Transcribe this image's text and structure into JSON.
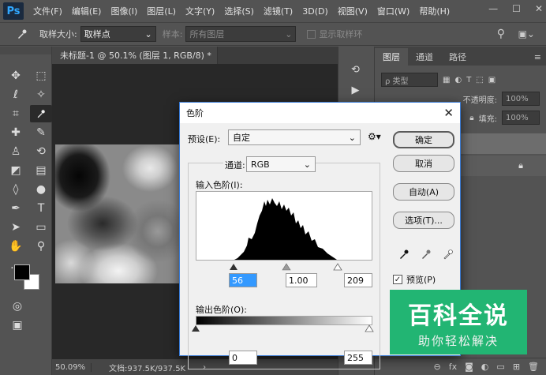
{
  "app": {
    "logo": "Ps"
  },
  "menubar": {
    "items": [
      "文件(F)",
      "编辑(E)",
      "图像(I)",
      "图层(L)",
      "文字(Y)",
      "选择(S)",
      "滤镜(T)",
      "3D(D)",
      "视图(V)",
      "窗口(W)",
      "帮助(H)"
    ],
    "window_controls": [
      "—",
      "☐",
      "✕"
    ]
  },
  "options": {
    "sample_size_label": "取样大小:",
    "sample_size_value": "取样点",
    "sample_label": "样本:",
    "sample_value": "所有图层",
    "show_ring_label": "显示取样环"
  },
  "document": {
    "tab_title": "未标题-1 @ 50.1% (图层 1, RGB/8) *",
    "zoom": "50.09%",
    "doc_info": "文档:937.5K/937.5K"
  },
  "layers_panel": {
    "tabs": [
      "图层",
      "通道",
      "路径"
    ],
    "filter_label": "ρ 类型",
    "opacity_label": "不透明度:",
    "opacity_value": "100%",
    "fill_label": "填充:",
    "fill_value": "100%"
  },
  "levels_dialog": {
    "title": "色阶",
    "close": "✕",
    "preset_label": "预设(E):",
    "preset_value": "自定",
    "channel_label": "通道:",
    "channel_value": "RGB",
    "input_label": "输入色阶(I):",
    "input_black": "56",
    "input_gamma": "1.00",
    "input_white": "209",
    "output_label": "输出色阶(O):",
    "output_black": "0",
    "output_white": "255",
    "buttons": {
      "ok": "确定",
      "cancel": "取消",
      "auto": "自动(A)",
      "options": "选项(T)..."
    },
    "preview_label": "预览(P)",
    "preview_checked": true
  },
  "watermark": {
    "title": "百科全说",
    "subtitle": "助你轻松解决"
  },
  "colors": {
    "accent": "#3a7bd5",
    "watermark_green": "#22b573",
    "ps_blue": "#31a8ff"
  }
}
